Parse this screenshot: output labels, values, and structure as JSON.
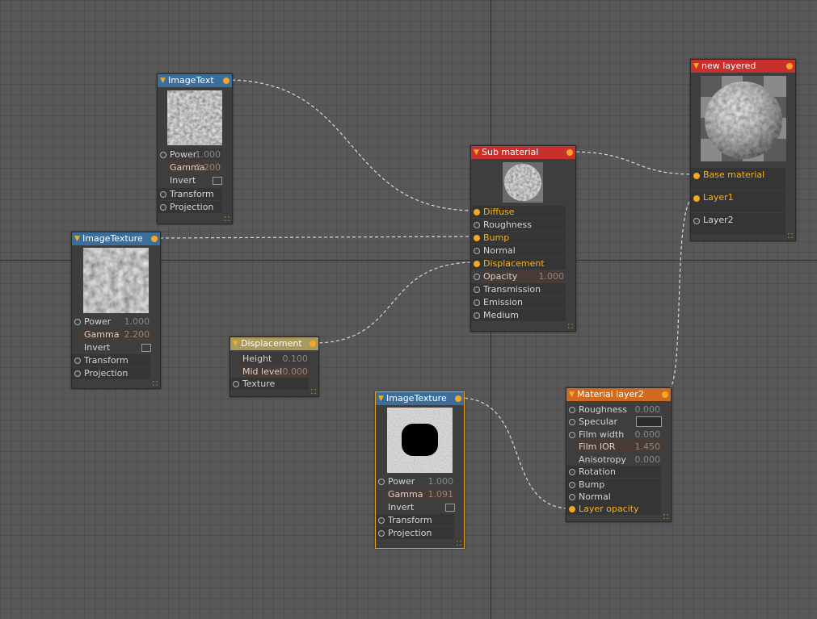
{
  "colors": {
    "wire": "#d9d9d9",
    "socket_active": "#f5a623",
    "header_blue": "#3b6e9a",
    "header_red": "#c8302e",
    "header_khaki": "#a89a5c",
    "header_orange": "#d06a20"
  },
  "icons": {
    "collapse": "triangle-down-icon",
    "resize": "resize-grip-icon",
    "output": "output-socket-icon"
  },
  "nodes": {
    "imagetext": {
      "title": "ImageText",
      "rows": {
        "power_label": "Power",
        "power_value": "1.000",
        "gamma_label": "Gamma",
        "gamma_value": "2.200",
        "invert_label": "Invert",
        "transform_label": "Transform",
        "projection_label": "Projection"
      }
    },
    "imagetexture1": {
      "title": "ImageTexture",
      "rows": {
        "power_label": "Power",
        "power_value": "1.000",
        "gamma_label": "Gamma",
        "gamma_value": "2.200",
        "invert_label": "Invert",
        "transform_label": "Transform",
        "projection_label": "Projection"
      }
    },
    "displacement": {
      "title": "Displacement",
      "rows": {
        "height_label": "Height",
        "height_value": "0.100",
        "midlevel_label": "Mid level",
        "midlevel_value": "0.000",
        "texture_label": "Texture"
      }
    },
    "submaterial": {
      "title": "Sub material",
      "rows": {
        "diffuse": "Diffuse",
        "roughness": "Roughness",
        "bump": "Bump",
        "normal": "Normal",
        "displacement": "Displacement",
        "opacity_label": "Opacity",
        "opacity_value": "1.000",
        "transmission": "Transmission",
        "emission": "Emission",
        "medium": "Medium"
      }
    },
    "imagetexture2": {
      "title": "ImageTexture",
      "rows": {
        "power_label": "Power",
        "power_value": "1.000",
        "gamma_label": "Gamma",
        "gamma_value": "1.091",
        "invert_label": "Invert",
        "transform_label": "Transform",
        "projection_label": "Projection"
      }
    },
    "materiallayer2": {
      "title": "Material layer2",
      "rows": {
        "roughness_label": "Roughness",
        "roughness_value": "0.000",
        "specular_label": "Specular",
        "filmwidth_label": "Film width",
        "filmwidth_value": "0.000",
        "filmior_label": "Film IOR",
        "filmior_value": "1.450",
        "anisotropy_label": "Anisotropy",
        "anisotropy_value": "0.000",
        "rotation": "Rotation",
        "bump": "Bump",
        "normal": "Normal",
        "layeropacity": "Layer opacity"
      }
    },
    "newlayered": {
      "title": "new layered",
      "rows": {
        "basematerial": "Base material",
        "layer1": "Layer1",
        "layer2": "Layer2"
      }
    }
  }
}
